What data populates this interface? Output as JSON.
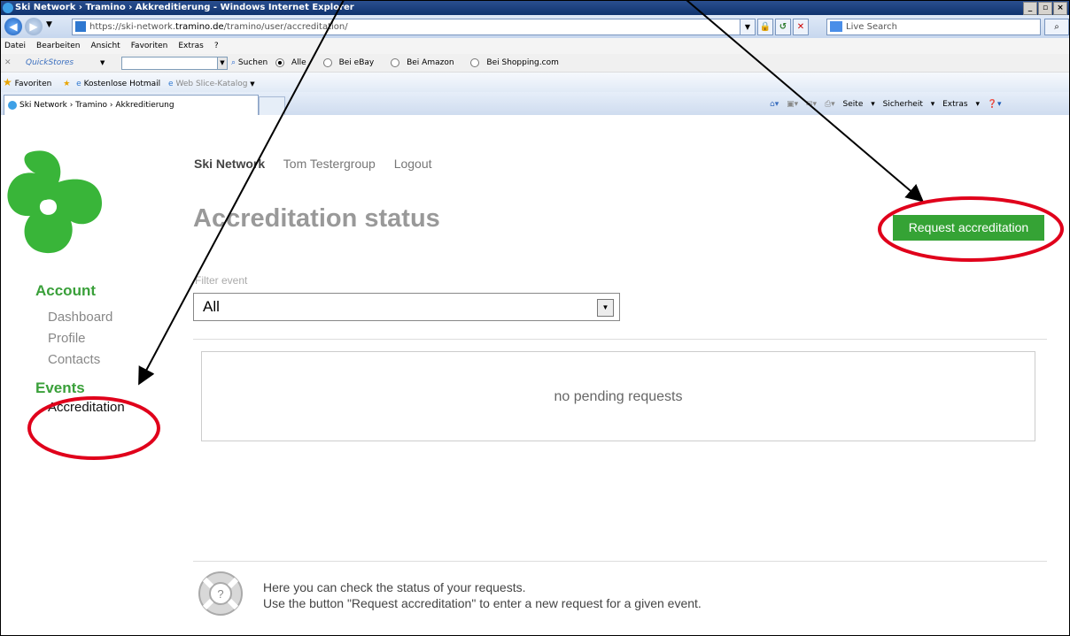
{
  "browser": {
    "window_title": "Ski Network › Tramino › Akkreditierung - Windows Internet Explorer",
    "url_prefix": "https://ski-network.",
    "url_domain": "tramino.de",
    "url_path": "/tramino/user/accreditation/",
    "live_search_placeholder": "Live Search",
    "menu": [
      "Datei",
      "Bearbeiten",
      "Ansicht",
      "Favoriten",
      "Extras",
      "?"
    ],
    "quickstores": {
      "label": "QuickStores",
      "search_label": "Suchen",
      "options": [
        "Alle",
        "Bei eBay",
        "Bei Amazon",
        "Bei Shopping.com"
      ]
    },
    "favorites": {
      "label": "Favoriten",
      "items": [
        "Kostenlose Hotmail",
        "Web Slice-Katalog"
      ]
    },
    "tab_title": "Ski Network › Tramino › Akkreditierung",
    "command_bar": [
      "Seite",
      "Sicherheit",
      "Extras"
    ]
  },
  "page": {
    "topnav": {
      "brand": "Ski Network",
      "user": "Tom Testergroup",
      "logout": "Logout"
    },
    "title": "Accreditation status",
    "request_button": "Request accreditation",
    "sidebar": {
      "account_heading": "Account",
      "account_items": [
        "Dashboard",
        "Profile",
        "Contacts"
      ],
      "events_heading": "Events",
      "events_items": [
        "Accreditation"
      ]
    },
    "filter": {
      "label": "Filter event",
      "value": "All"
    },
    "empty_message": "no pending requests",
    "help": {
      "line1": "Here you can check the status of your requests.",
      "line2": "Use the button \"Request accreditation\" to enter a new request for a given event."
    }
  },
  "colors": {
    "brand_green": "#35a335",
    "heading_green": "#3aa03a",
    "annotation_red": "#e0001b"
  }
}
